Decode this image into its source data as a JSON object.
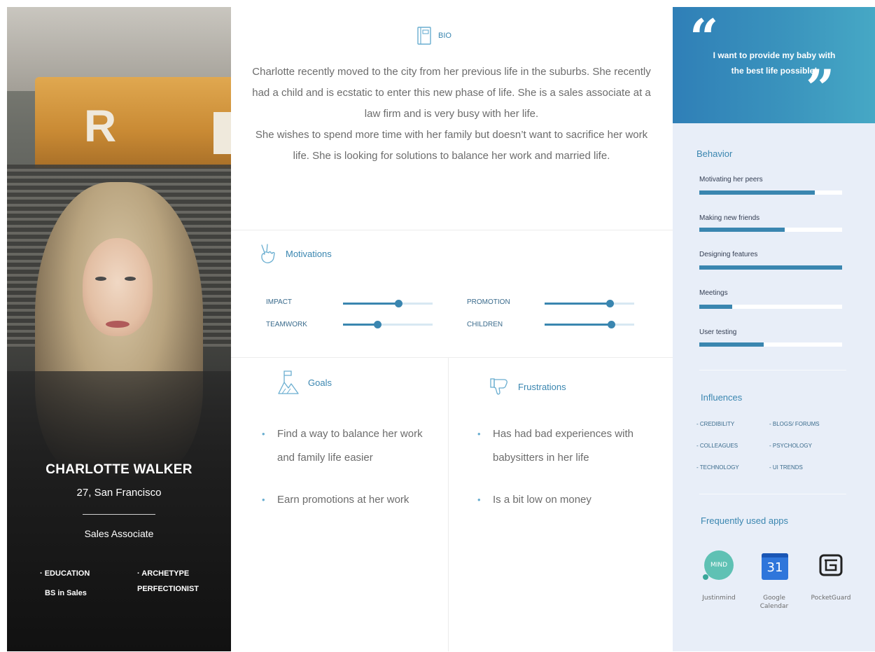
{
  "profile": {
    "name": "CHARLOTTE WALKER",
    "age_location": "27, San Francisco",
    "role": "Sales Associate",
    "education_label": "· EDUCATION",
    "education_value": "BS in Sales",
    "archetype_label": "· ARCHETYPE",
    "archetype_value": "PERFECTIONIST"
  },
  "bio": {
    "title": "BIO",
    "text": "Charlotte recently moved to the city from her previous life in the suburbs. She recently had a child and is ecstatic to enter this new phase of life. She is a sales associate at a law firm and is very busy with her life.",
    "text2": "She wishes to spend more time with her family but doesn’t want to sacrifice her work life. She is looking for solutions to balance her work and married life."
  },
  "motivations": {
    "title": "Motivations",
    "items": [
      {
        "label": "IMPACT",
        "level": 0.62
      },
      {
        "label": "TEAMWORK",
        "level": 0.38
      },
      {
        "label": "PROMOTION",
        "level": 0.73
      },
      {
        "label": "CHILDREN",
        "level": 0.74
      }
    ]
  },
  "goals": {
    "title": "Goals",
    "items": [
      "Find a way to balance her work and family life easier",
      "Earn promotions at her work"
    ]
  },
  "frustrations": {
    "title": "Frustrations",
    "items": [
      "Has had bad experiences with babysitters in her life",
      "Is a bit low on money"
    ]
  },
  "quote": {
    "open_mark": "“",
    "close_mark": "”",
    "text": "I want to provide my baby with the best life possible!"
  },
  "behavior": {
    "title": "Behavior",
    "items": [
      {
        "label": "Motivating her peers",
        "level": 0.81
      },
      {
        "label": "Making new friends",
        "level": 0.6
      },
      {
        "label": "Designing features",
        "level": 1.0
      },
      {
        "label": "Meetings",
        "level": 0.23
      },
      {
        "label": "User testing",
        "level": 0.45
      }
    ]
  },
  "influences": {
    "title": "Influences",
    "items": [
      "- CREDIBILITY",
      "- BLOGS/ FORUMS",
      "- COLLEAGUES",
      "- PSYCHOLOGY",
      "- TECHNOLOGY",
      "- UI TRENDS"
    ]
  },
  "apps": {
    "title": "Frequently used apps",
    "items": [
      {
        "name": "Justinmind",
        "icon": "justinmind-icon",
        "icon_text": "MIND"
      },
      {
        "name": "Google Calendar",
        "icon": "google-calendar-icon",
        "icon_text": "31"
      },
      {
        "name": "PocketGuard",
        "icon": "pocketguard-icon",
        "icon_text": ""
      }
    ]
  },
  "colors": {
    "accent": "#3a86b0",
    "quote_gradient_start": "#2f7fb7",
    "quote_gradient_end": "#46a8c5",
    "right_panel_bg": "#e8eef8"
  }
}
